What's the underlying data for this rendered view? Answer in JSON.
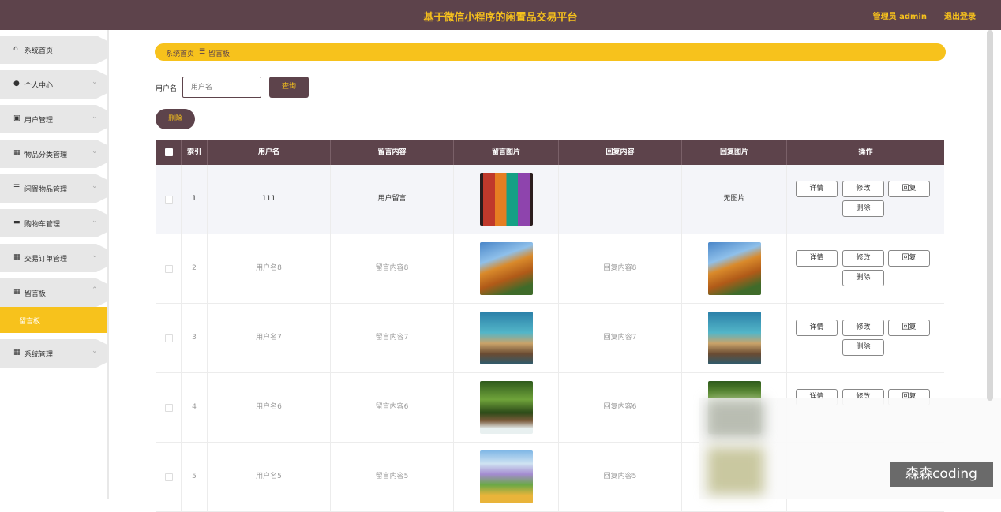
{
  "header": {
    "title": "基于微信小程序的闲置品交易平台",
    "admin": "管理员 admin",
    "logout": "退出登录"
  },
  "sidebar": {
    "items": [
      {
        "label": "系统首页",
        "icon": "home-icon"
      },
      {
        "label": "个人中心",
        "icon": "user-icon"
      },
      {
        "label": "用户管理",
        "icon": "clipboard-icon"
      },
      {
        "label": "物品分类管理",
        "icon": "grid-icon"
      },
      {
        "label": "闲置物品管理",
        "icon": "list-icon"
      },
      {
        "label": "购物车管理",
        "icon": "cart-icon"
      },
      {
        "label": "交易订单管理",
        "icon": "grid-icon"
      },
      {
        "label": "留言板",
        "icon": "grid-icon"
      },
      {
        "label": "系统管理",
        "icon": "grid-icon"
      }
    ],
    "subitem": "留言板"
  },
  "breadcrumb": {
    "home": "系统首页",
    "sep": "☰",
    "current": "留言板"
  },
  "search": {
    "label": "用户名",
    "placeholder": "用户名",
    "button": "查询"
  },
  "delete_button": "删除",
  "table": {
    "headers": [
      "索引",
      "用户名",
      "留言内容",
      "留言图片",
      "回复内容",
      "回复图片",
      "操作"
    ],
    "actions": {
      "detail": "详情",
      "edit": "修改",
      "reply": "回复",
      "delete": "删除"
    },
    "rows": [
      {
        "index": "1",
        "username": "111",
        "content": "用户留言",
        "reply": "",
        "reply_image": "无图片"
      },
      {
        "index": "2",
        "username": "用户名8",
        "content": "留言内容8",
        "reply": "回复内容8",
        "reply_image": ""
      },
      {
        "index": "3",
        "username": "用户名7",
        "content": "留言内容7",
        "reply": "回复内容7",
        "reply_image": ""
      },
      {
        "index": "4",
        "username": "用户名6",
        "content": "留言内容6",
        "reply": "回复内容6",
        "reply_image": ""
      },
      {
        "index": "5",
        "username": "用户名5",
        "content": "留言内容5",
        "reply": "回复内容5",
        "reply_image": ""
      }
    ]
  },
  "watermark": "森森coding",
  "colors": {
    "primary": "#5d434b",
    "accent": "#f7c21c"
  }
}
